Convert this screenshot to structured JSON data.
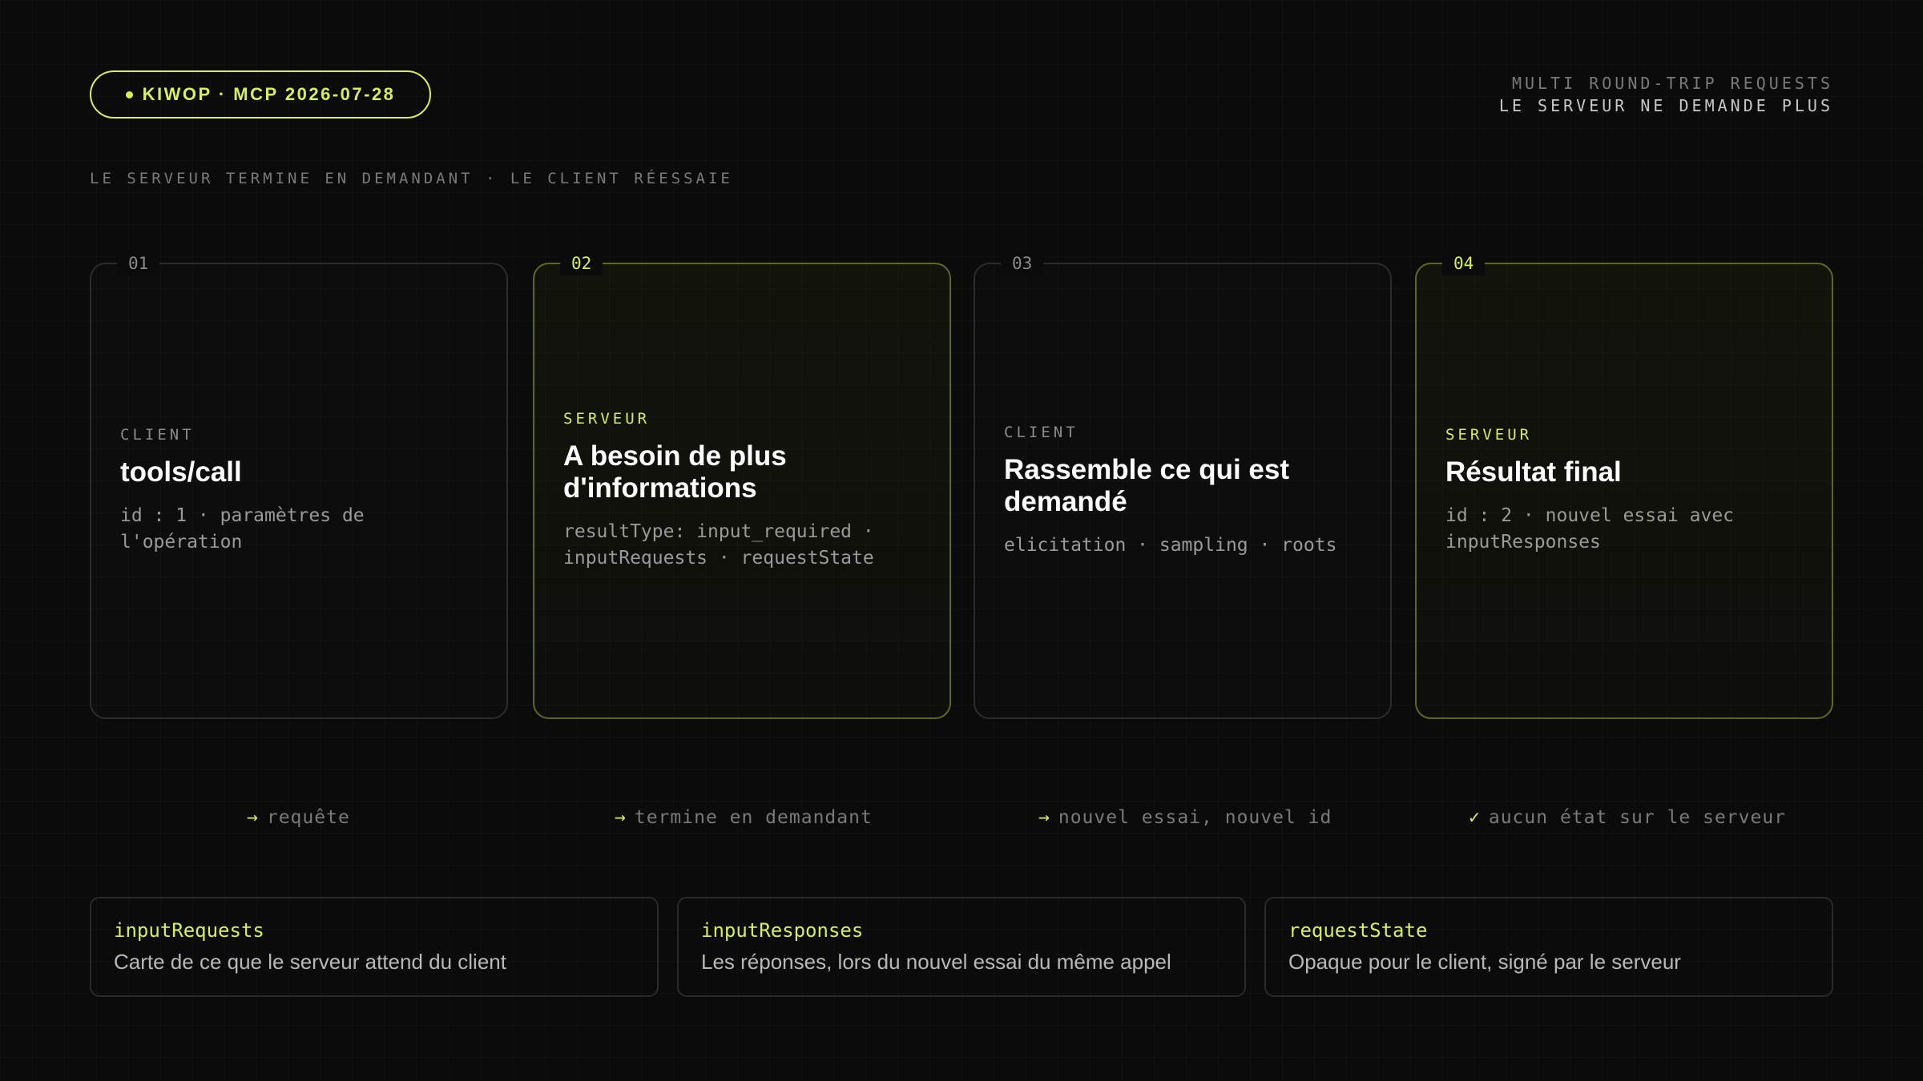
{
  "badge": {
    "label": "KIWOP · MCP 2026-07-28"
  },
  "header": {
    "line1": "MULTI ROUND-TRIP REQUESTS",
    "line2": "LE SERVEUR NE DEMANDE PLUS"
  },
  "subtitle": "LE SERVEUR TERMINE EN DEMANDANT · LE CLIENT RÉESSAIE",
  "steps": [
    {
      "num": "01",
      "role": "CLIENT",
      "title": "tools/call",
      "desc": "id : 1 · paramètres de l'opération",
      "highlight": false
    },
    {
      "num": "02",
      "role": "SERVEUR",
      "title": "A besoin de plus d'informations",
      "desc": "resultType: input_required · inputRequests · requestState",
      "highlight": true
    },
    {
      "num": "03",
      "role": "CLIENT",
      "title": "Rassemble ce qui est demandé",
      "desc": "elicitation · sampling · roots",
      "highlight": false
    },
    {
      "num": "04",
      "role": "SERVEUR",
      "title": "Résultat final",
      "desc": "id : 2 · nouvel essai avec inputResponses",
      "highlight": true
    }
  ],
  "captions": [
    {
      "icon": "→",
      "text": "requête"
    },
    {
      "icon": "→",
      "text": "termine en demandant"
    },
    {
      "icon": "→",
      "text": "nouvel essai, nouvel id"
    },
    {
      "icon": "✓",
      "text": "aucun état sur le serveur"
    }
  ],
  "fields": [
    {
      "key": "inputRequests",
      "desc": "Carte de ce que le serveur attend du client"
    },
    {
      "key": "inputResponses",
      "desc": "Les réponses, lors du nouvel essai du même appel"
    },
    {
      "key": "requestState",
      "desc": "Opaque pour le client, signé par le serveur"
    }
  ],
  "colors": {
    "accent": "#d4f05a",
    "background": "#0b0b0b"
  }
}
